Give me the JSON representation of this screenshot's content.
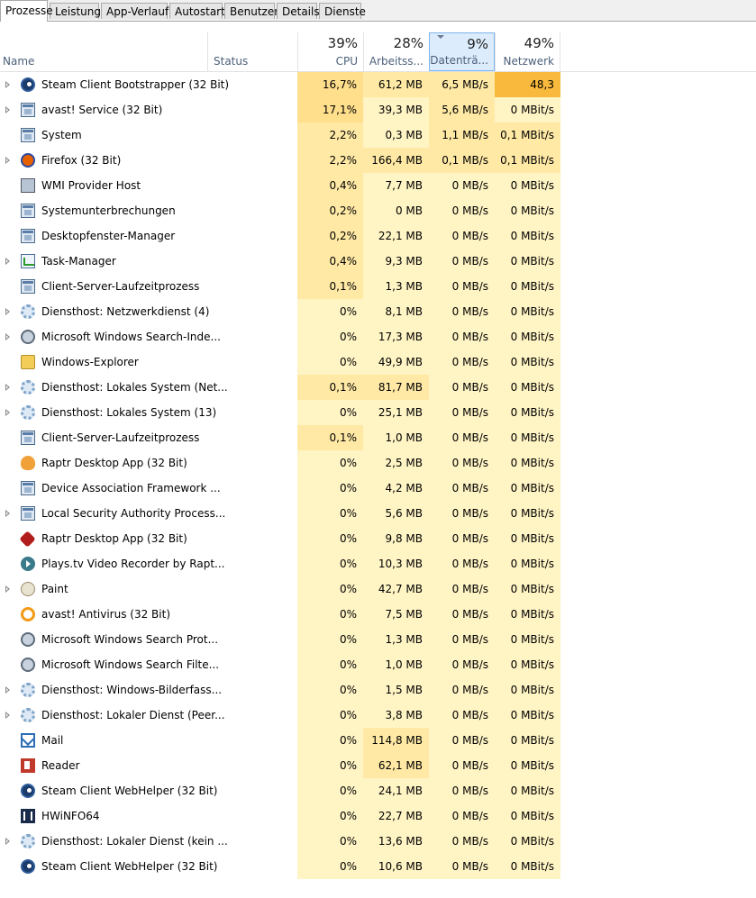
{
  "tabs": [
    "Prozesse",
    "Leistung",
    "App-Verlauf",
    "Autostart",
    "Benutzer",
    "Details",
    "Dienste"
  ],
  "columns": {
    "name": "Name",
    "status": "Status",
    "cpu": {
      "pct": "39%",
      "label": "CPU"
    },
    "mem": {
      "pct": "28%",
      "label": "Arbeitss..."
    },
    "disk": {
      "pct": "9%",
      "label": "Datenträ..."
    },
    "net": {
      "pct": "49%",
      "label": "Netzwerk"
    }
  },
  "colors": {
    "heat_light": "#fff4c4",
    "heat_medium": "#ffe9a5",
    "heat_strong": "#ffde8c",
    "net_hot": "#f8b93c",
    "sorted_header": "#dcecfc"
  },
  "rows": [
    {
      "expand": true,
      "icon": "steam-icon",
      "name": "Steam Client Bootstrapper (32 Bit)",
      "cpu": "16,7%",
      "mem": "61,2 MB",
      "disk": "6,5 MB/s",
      "net": "48,3 MBit/s"
    },
    {
      "expand": true,
      "icon": "service-window-icon",
      "name": "avast! Service (32 Bit)",
      "cpu": "17,1%",
      "mem": "39,3 MB",
      "disk": "5,6 MB/s",
      "net": "0 MBit/s"
    },
    {
      "expand": false,
      "icon": "service-window-icon",
      "name": "System",
      "cpu": "2,2%",
      "mem": "0,3 MB",
      "disk": "1,1 MB/s",
      "net": "0,1 MBit/s"
    },
    {
      "expand": true,
      "icon": "firefox-icon",
      "name": "Firefox (32 Bit)",
      "cpu": "2,2%",
      "mem": "166,4 MB",
      "disk": "0,1 MB/s",
      "net": "0,1 MBit/s"
    },
    {
      "expand": false,
      "icon": "wmi-icon",
      "name": "WMI Provider Host",
      "cpu": "0,4%",
      "mem": "7,7 MB",
      "disk": "0 MB/s",
      "net": "0 MBit/s"
    },
    {
      "expand": false,
      "icon": "service-window-icon",
      "name": "Systemunterbrechungen",
      "cpu": "0,2%",
      "mem": "0 MB",
      "disk": "0 MB/s",
      "net": "0 MBit/s"
    },
    {
      "expand": false,
      "icon": "service-window-icon",
      "name": "Desktopfenster-Manager",
      "cpu": "0,2%",
      "mem": "22,1 MB",
      "disk": "0 MB/s",
      "net": "0 MBit/s"
    },
    {
      "expand": true,
      "icon": "task-manager-icon",
      "name": "Task-Manager",
      "cpu": "0,4%",
      "mem": "9,3 MB",
      "disk": "0 MB/s",
      "net": "0 MBit/s"
    },
    {
      "expand": false,
      "icon": "service-window-icon",
      "name": "Client-Server-Laufzeitprozess",
      "cpu": "0,1%",
      "mem": "1,3 MB",
      "disk": "0 MB/s",
      "net": "0 MBit/s"
    },
    {
      "expand": true,
      "icon": "gear-icon",
      "name": "Diensthost: Netzwerkdienst (4)",
      "cpu": "0%",
      "mem": "8,1 MB",
      "disk": "0 MB/s",
      "net": "0 MBit/s"
    },
    {
      "expand": true,
      "icon": "search-indexer-icon",
      "name": "Microsoft Windows Search-Inde...",
      "cpu": "0%",
      "mem": "17,3 MB",
      "disk": "0 MB/s",
      "net": "0 MBit/s"
    },
    {
      "expand": false,
      "icon": "folder-icon",
      "name": "Windows-Explorer",
      "cpu": "0%",
      "mem": "49,9 MB",
      "disk": "0 MB/s",
      "net": "0 MBit/s"
    },
    {
      "expand": true,
      "icon": "gear-icon",
      "name": "Diensthost: Lokales System (Net...",
      "cpu": "0,1%",
      "mem": "81,7 MB",
      "disk": "0 MB/s",
      "net": "0 MBit/s"
    },
    {
      "expand": true,
      "icon": "gear-icon",
      "name": "Diensthost: Lokales System (13)",
      "cpu": "0%",
      "mem": "25,1 MB",
      "disk": "0 MB/s",
      "net": "0 MBit/s"
    },
    {
      "expand": false,
      "icon": "service-window-icon",
      "name": "Client-Server-Laufzeitprozess",
      "cpu": "0,1%",
      "mem": "1,0 MB",
      "disk": "0 MB/s",
      "net": "0 MBit/s"
    },
    {
      "expand": false,
      "icon": "raptr-icon",
      "name": "Raptr Desktop App (32 Bit)",
      "cpu": "0%",
      "mem": "2,5 MB",
      "disk": "0 MB/s",
      "net": "0 MBit/s"
    },
    {
      "expand": false,
      "icon": "service-window-icon",
      "name": "Device Association Framework ...",
      "cpu": "0%",
      "mem": "4,2 MB",
      "disk": "0 MB/s",
      "net": "0 MBit/s"
    },
    {
      "expand": true,
      "icon": "service-window-icon",
      "name": "Local Security Authority Process...",
      "cpu": "0%",
      "mem": "5,6 MB",
      "disk": "0 MB/s",
      "net": "0 MBit/s"
    },
    {
      "expand": false,
      "icon": "raptr-red-icon",
      "name": "Raptr Desktop App (32 Bit)",
      "cpu": "0%",
      "mem": "9,8 MB",
      "disk": "0 MB/s",
      "net": "0 MBit/s"
    },
    {
      "expand": false,
      "icon": "plays-tv-icon",
      "name": "Plays.tv Video Recorder by Rapt...",
      "cpu": "0%",
      "mem": "10,3 MB",
      "disk": "0 MB/s",
      "net": "0 MBit/s"
    },
    {
      "expand": true,
      "icon": "paint-icon",
      "name": "Paint",
      "cpu": "0%",
      "mem": "42,7 MB",
      "disk": "0 MB/s",
      "net": "0 MBit/s"
    },
    {
      "expand": false,
      "icon": "avast-icon",
      "name": "avast! Antivirus (32 Bit)",
      "cpu": "0%",
      "mem": "7,5 MB",
      "disk": "0 MB/s",
      "net": "0 MBit/s"
    },
    {
      "expand": false,
      "icon": "search-indexer-icon",
      "name": "Microsoft Windows Search Prot...",
      "cpu": "0%",
      "mem": "1,3 MB",
      "disk": "0 MB/s",
      "net": "0 MBit/s"
    },
    {
      "expand": false,
      "icon": "search-indexer-icon",
      "name": "Microsoft Windows Search Filte...",
      "cpu": "0%",
      "mem": "1,0 MB",
      "disk": "0 MB/s",
      "net": "0 MBit/s"
    },
    {
      "expand": true,
      "icon": "gear-icon",
      "name": "Diensthost: Windows-Bilderfass...",
      "cpu": "0%",
      "mem": "1,5 MB",
      "disk": "0 MB/s",
      "net": "0 MBit/s"
    },
    {
      "expand": true,
      "icon": "gear-icon",
      "name": "Diensthost: Lokaler Dienst (Peer...",
      "cpu": "0%",
      "mem": "3,8 MB",
      "disk": "0 MB/s",
      "net": "0 MBit/s"
    },
    {
      "expand": false,
      "icon": "mail-icon",
      "name": "Mail",
      "cpu": "0%",
      "mem": "114,8 MB",
      "disk": "0 MB/s",
      "net": "0 MBit/s"
    },
    {
      "expand": false,
      "icon": "reader-icon",
      "name": "Reader",
      "cpu": "0%",
      "mem": "62,1 MB",
      "disk": "0 MB/s",
      "net": "0 MBit/s"
    },
    {
      "expand": false,
      "icon": "steam-icon",
      "name": "Steam Client WebHelper (32 Bit)",
      "cpu": "0%",
      "mem": "24,1 MB",
      "disk": "0 MB/s",
      "net": "0 MBit/s"
    },
    {
      "expand": false,
      "icon": "hwinfo-icon",
      "name": "HWiNFO64",
      "cpu": "0%",
      "mem": "22,7 MB",
      "disk": "0 MB/s",
      "net": "0 MBit/s"
    },
    {
      "expand": true,
      "icon": "gear-icon",
      "name": "Diensthost: Lokaler Dienst (kein ...",
      "cpu": "0%",
      "mem": "13,6 MB",
      "disk": "0 MB/s",
      "net": "0 MBit/s"
    },
    {
      "expand": false,
      "icon": "steam-icon",
      "name": "Steam Client WebHelper (32 Bit)",
      "cpu": "0%",
      "mem": "10,6 MB",
      "disk": "0 MB/s",
      "net": "0 MBit/s"
    }
  ]
}
